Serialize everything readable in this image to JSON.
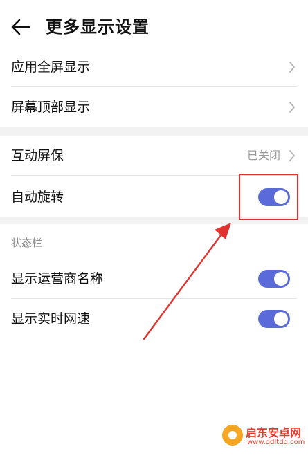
{
  "header": {
    "title": "更多显示设置",
    "back_icon": "arrow-left-icon"
  },
  "group1": [
    {
      "label": "应用全屏显示"
    },
    {
      "label": "屏幕顶部显示"
    }
  ],
  "group2": {
    "screensaver": {
      "label": "互动屏保",
      "status": "已关闭"
    },
    "auto_rotate": {
      "label": "自动旋转",
      "enabled": true
    }
  },
  "status_bar": {
    "section_title": "状态栏",
    "items": [
      {
        "label": "显示运营商名称",
        "enabled": true
      },
      {
        "label": "显示实时网速",
        "enabled": true
      }
    ]
  },
  "colors": {
    "accent": "#5b6ad9",
    "annotation": "#e0322f"
  },
  "watermark": {
    "name": "启东安卓网",
    "url": "www.qdltdq.com"
  }
}
